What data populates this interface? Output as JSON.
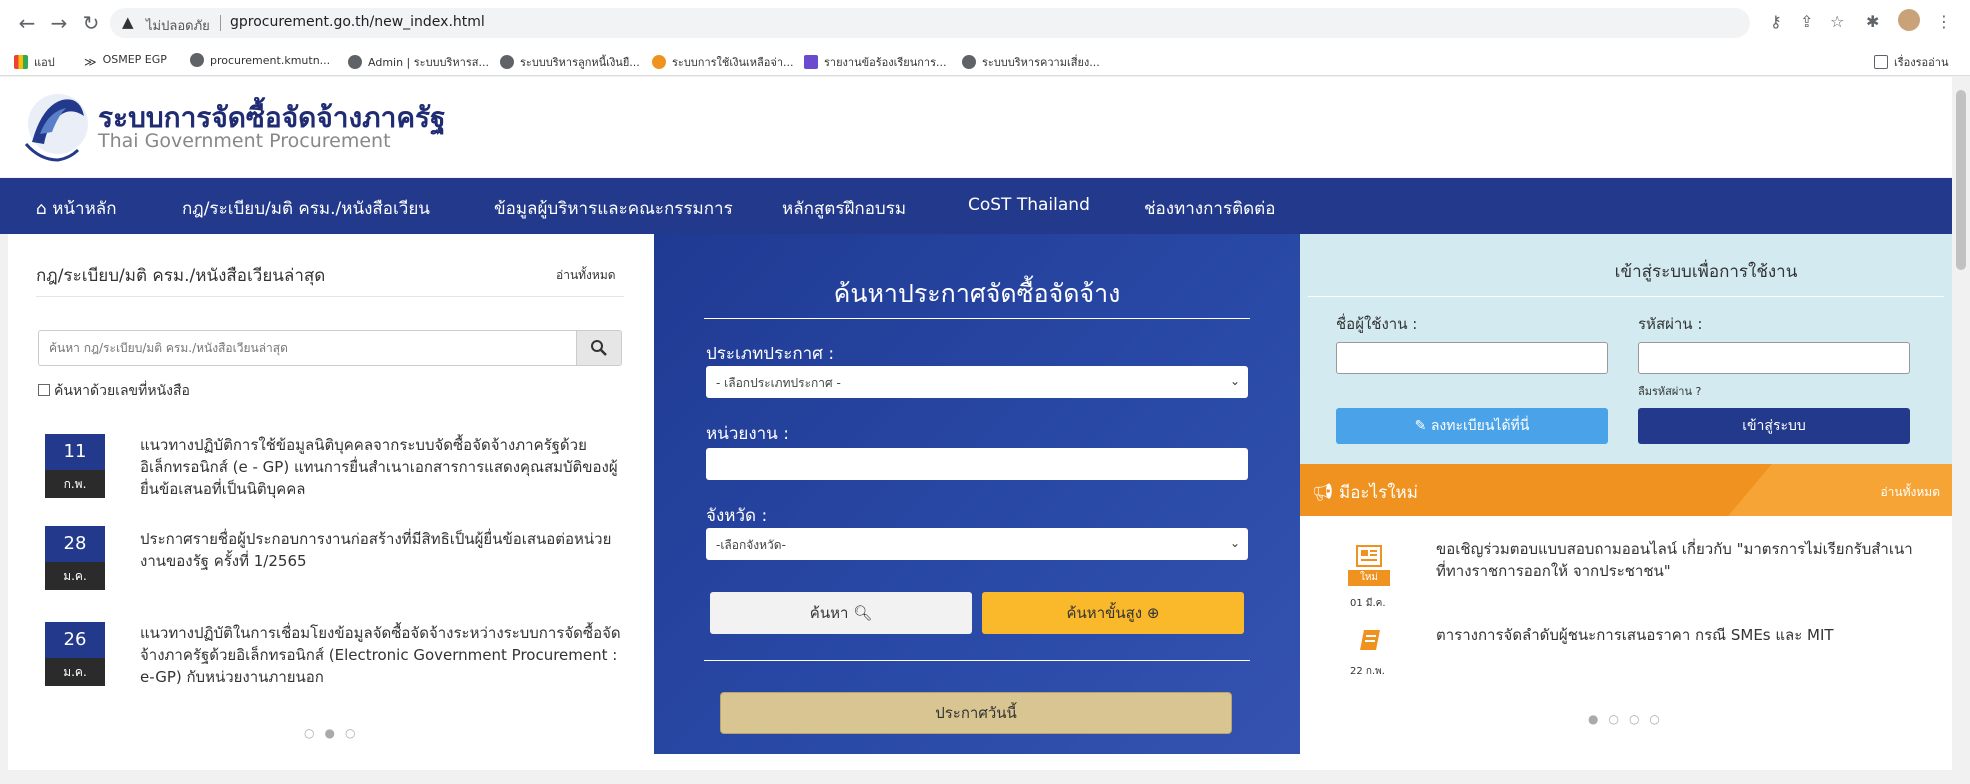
{
  "browser": {
    "security_label": "ไม่ปลอดภัย",
    "url": "gprocurement.go.th/new_index.html",
    "bookmarks": [
      "แอป",
      "OSMEP EGP",
      "procurement.kmutn...",
      "Admin | ระบบบริหารส...",
      "ระบบบริหารลูกหนี้เงินยื...",
      "ระบบการใช้เงินเหลือจ่า...",
      "รายงานข้อร้องเรียนการ...",
      "ระบบบริหารความเสี่ยง..."
    ],
    "reading_list": "เรื่องรออ่าน"
  },
  "site": {
    "title": "ระบบการจัดซื้อจัดจ้างภาครัฐ",
    "subtitle": "Thai Government Procurement"
  },
  "nav": {
    "items": [
      "หน้าหลัก",
      "กฎ/ระเบียบ/มติ ครม./หนังสือเวียน",
      "ข้อมูลผู้บริหารและคณะกรรมการ",
      "หลักสูตรฝึกอบรม",
      "CoST Thailand",
      "ช่องทางการติดต่อ"
    ]
  },
  "left": {
    "title": "กฎ/ระเบียบ/มติ ครม./หนังสือเวียนล่าสุด",
    "read_all": "อ่านทั้งหมด",
    "search_placeholder": "ค้นหา กฎ/ระเบียบ/มติ ครม./หนังสือเวียนล่าสุด",
    "checkbox_label": "ค้นหาด้วยเลขที่หนังสือ",
    "news": [
      {
        "day": "11",
        "month": "ก.พ.",
        "text": "แนวทางปฏิบัติการใช้ข้อมูลนิติบุคคลจากระบบจัดซื้อจัดจ้างภาครัฐด้วยอิเล็กทรอนิกส์ (e - GP) แทนการยื่นสำเนาเอกสารการแสดงคุณสมบัติของผู้ยื่นข้อเสนอที่เป็นนิติบุคคล"
      },
      {
        "day": "28",
        "month": "ม.ค.",
        "text": "ประกาศรายชื่อผู้ประกอบการงานก่อสร้างที่มีสิทธิเป็นผู้ยื่นข้อเสนอต่อหน่วยงานของรัฐ ครั้งที่ 1/2565"
      },
      {
        "day": "26",
        "month": "ม.ค.",
        "text": "แนวทางปฏิบัติในการเชื่อมโยงข้อมูลจัดซื้อจัดจ้างระหว่างระบบการจัดซื้อจัดจ้างภาครัฐด้วยอิเล็กทรอนิกส์ (Electronic Government Procurement : e-GP) กับหน่วยงานภายนอก"
      }
    ],
    "pager": "○●○"
  },
  "center": {
    "title": "ค้นหาประกาศจัดซื้อจัดจ้าง",
    "type_label": "ประเภทประกาศ :",
    "type_value": "- เลือกประเภทประกาศ -",
    "unit_label": "หน่วยงาน :",
    "province_label": "จังหวัด :",
    "province_value": "-เลือกจังหวัด-",
    "search_btn": "ค้นหา",
    "advanced_btn": "ค้นหาขั้นสูง",
    "today_btn": "ประกาศวันนี้"
  },
  "login": {
    "title": "เข้าสู่ระบบเพื่อการใช้งาน",
    "username_label": "ชื่อผู้ใช้งาน :",
    "password_label": "รหัสผ่าน :",
    "forgot": "ลืมรหัสผ่าน ?",
    "register_btn": "ลงทะเบียนได้ที่นี่",
    "login_btn": "เข้าสู่ระบบ"
  },
  "whatsnew": {
    "title": "มีอะไรใหม่",
    "read_all": "อ่านทั้งหมด",
    "badge": "ใหม่",
    "items": [
      {
        "date": "01 มี.ค.",
        "text": "ขอเชิญร่วมตอบแบบสอบถามออนไลน์ เกี่ยวกับ \"มาตรการไม่เรียกรับสำเนาที่ทางราชการออกให้ จากประชาชน\""
      },
      {
        "date": "22 ก.พ.",
        "text": "ตารางการจัดลำดับผู้ชนะการเสนอราคา กรณี SMEs และ MIT"
      }
    ],
    "pager": "●○○○"
  },
  "colors": {
    "primary": "#233a8c",
    "accent_orange": "#f0921f",
    "login_bg": "#d2eaf0",
    "gold_btn": "#f9b92b"
  }
}
